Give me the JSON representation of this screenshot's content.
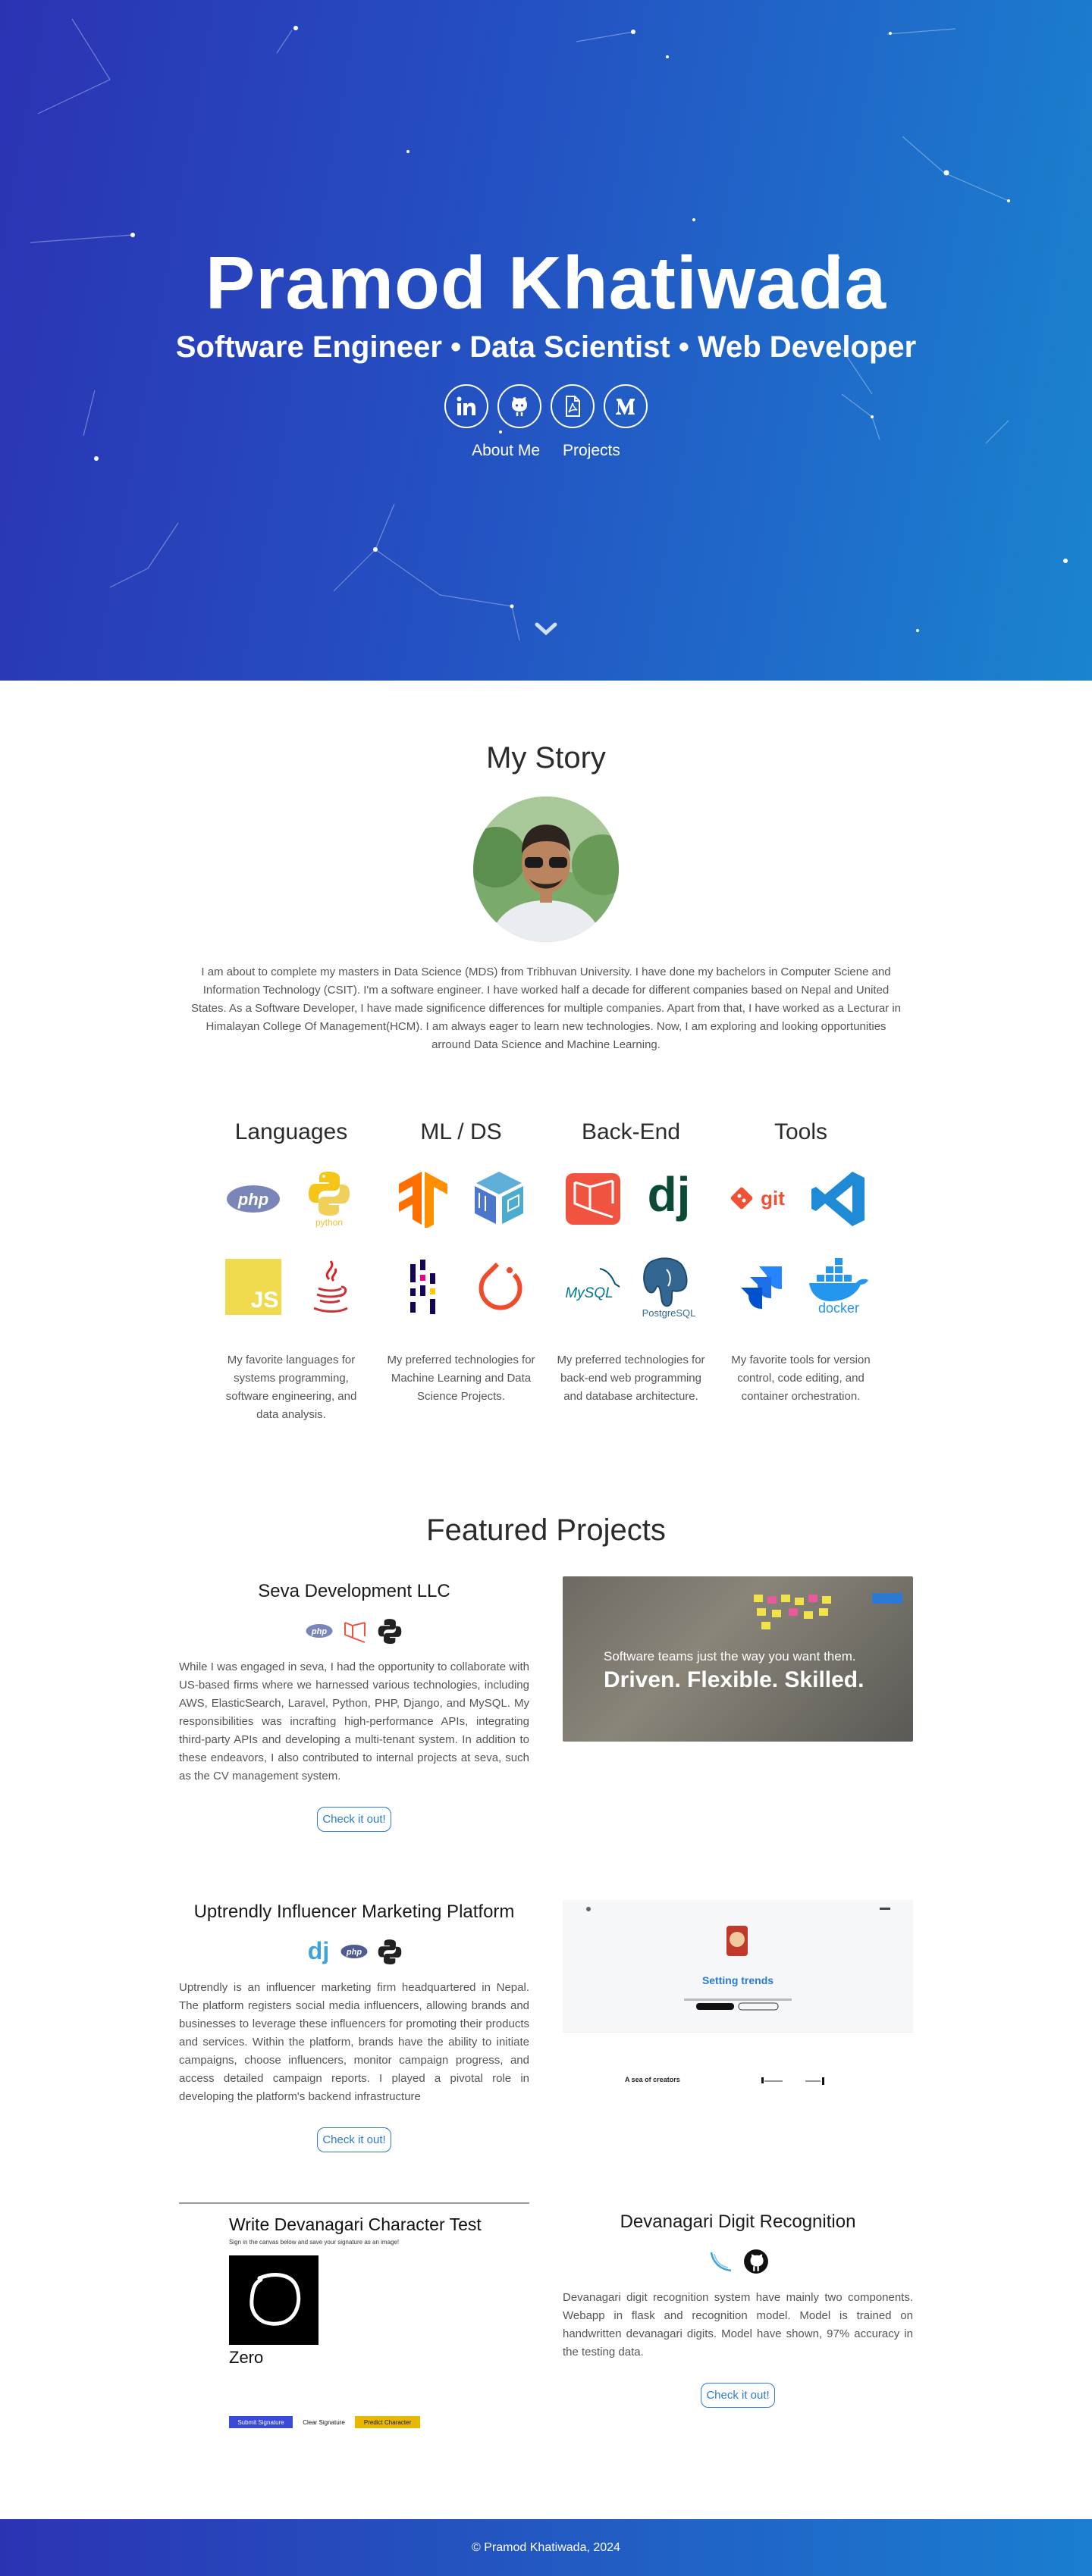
{
  "hero": {
    "name": "Pramod Khatiwada",
    "tagline": "Software Engineer • Data Scientist • Web Developer",
    "social": [
      "linkedin-icon",
      "github-icon",
      "pdf-icon",
      "medium-icon"
    ],
    "nav": {
      "about": "About Me",
      "projects": "Projects"
    }
  },
  "story": {
    "title": "My Story",
    "text": "I am about to complete my masters in Data Science (MDS) from Tribhuvan University. I have done my bachelors in Computer Sciene and Information Technology (CSIT). I'm a software engineer. I have worked half a decade for different companies based on Nepal and United States. As a Software Developer, I have made significence differences for multiple companies. Apart from that, I have worked as a Lecturar in Himalayan College Of Management(HCM). I am always eager to learn new technologies. Now, I am exploring and looking opportunities arround Data Science and Machine Learning."
  },
  "skills": [
    {
      "title": "Languages",
      "logos": [
        "php",
        "python",
        "javascript",
        "java"
      ],
      "desc": "My favorite languages for systems programming, software engineering, and data analysis."
    },
    {
      "title": "ML / DS",
      "logos": [
        "tensorflow",
        "numpy",
        "pandas",
        "pytorch"
      ],
      "desc": "My preferred technologies for Machine Learning and Data Science Projects."
    },
    {
      "title": "Back-End",
      "logos": [
        "laravel",
        "django",
        "mysql",
        "postgresql"
      ],
      "desc": "My preferred technologies for back-end web programming and database architecture."
    },
    {
      "title": "Tools",
      "logos": [
        "git",
        "vscode",
        "jira",
        "docker"
      ],
      "desc": "My favorite tools for version control, code editing, and container orchestration."
    }
  ],
  "projects_title": "Featured Projects",
  "projects": [
    {
      "title": "Seva Development LLC",
      "desc": "While I was engaged in seva, I had the opportunity to collaborate with US-based firms where we harnessed various technologies, including AWS, ElasticSearch, Laravel, Python, PHP, Django, and MySQL. My responsibilities was incrafting high-performance APIs, integrating third-party APIs and developing a multi-tenant system. In addition to these endeavors, I also contributed to internal projects at seva, such as the CV management system.",
      "button": "Check it out!",
      "shot_line1": "Software teams just the way you want them.",
      "shot_line2": "Driven. Flexible. Skilled."
    },
    {
      "title": "Uptrendly Influencer Marketing Platform",
      "desc": "Uptrendly is an influencer marketing firm headquartered in Nepal. The platform registers social media influencers, allowing brands and businesses to leverage these influencers for promoting their products and services. Within the platform, brands have the ability to initiate campaigns, choose influencers, monitor campaign progress, and access detailed campaign reports. I played a pivotal role in developing the platform's backend infrastructure",
      "button": "Check it out!",
      "shot_heading": "Setting trends",
      "shot_sub": "A sea of creators"
    },
    {
      "title": "Devanagari Digit Recognition",
      "desc": "Devanagari digit recognition system have mainly two components. Webapp in flask and recognition model. Model is trained on handwritten devanagari digits. Model have shown, 97% accuracy in the testing data.",
      "button": "Check it out!",
      "shot_title": "Write Devanagari Character Test",
      "shot_hint": "Sign in the canvas below and save your signature as an image!",
      "shot_result": "Zero",
      "shot_btn1": "Submit Signature",
      "shot_btn2": "Clear Signature",
      "shot_btn3": "Predict Character"
    }
  ],
  "footer": {
    "text": "© Pramod Khatiwada, 2024"
  }
}
